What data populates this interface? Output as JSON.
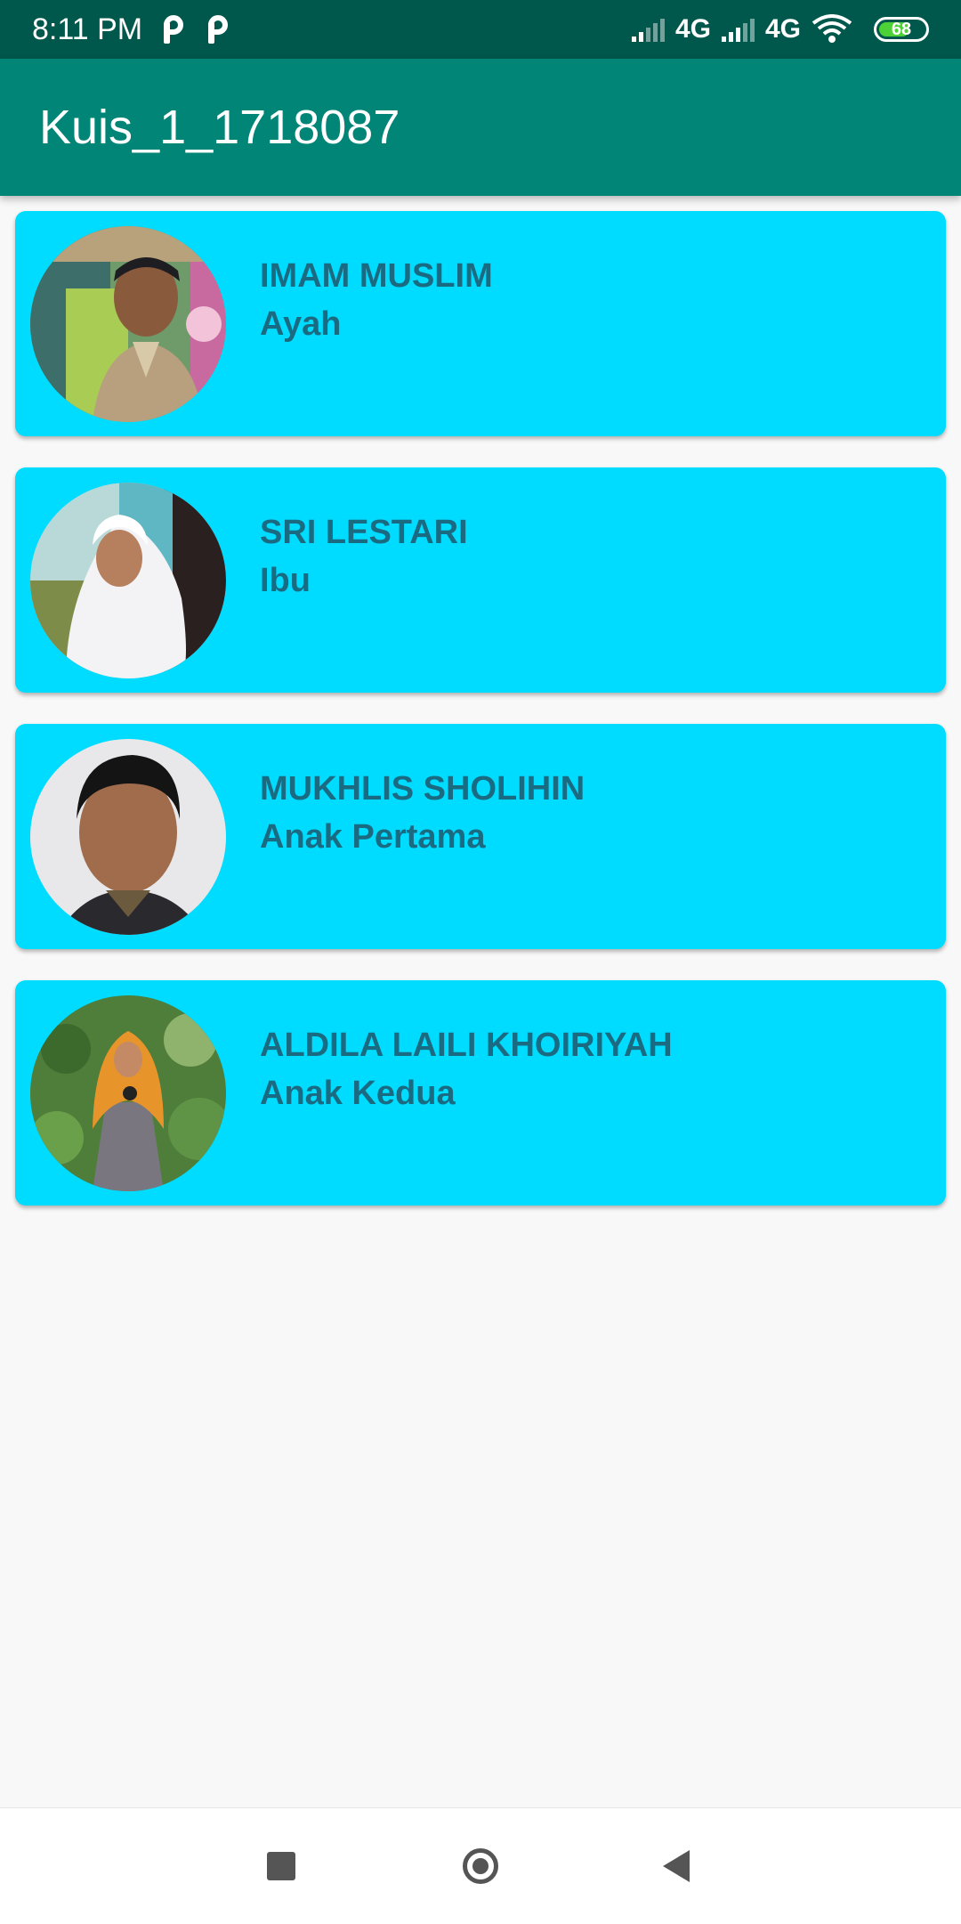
{
  "status_bar": {
    "time": "8:11 PM",
    "network1": "4G",
    "network2": "4G",
    "battery": "68",
    "battery_level": 0.68,
    "icons": [
      "parking-p-icon",
      "parking-p-icon",
      "signal-icon",
      "signal-icon",
      "wifi-icon",
      "battery-icon"
    ]
  },
  "app_bar": {
    "title": "Kuis_1_1718087"
  },
  "members": [
    {
      "name": "IMAM MUSLIM",
      "role": "Ayah",
      "avatar": "man-in-uniform-photo"
    },
    {
      "name": "SRI LESTARI",
      "role": "Ibu",
      "avatar": "woman-in-white-hijab-photo"
    },
    {
      "name": "MUKHLIS SHOLIHIN",
      "role": "Anak Pertama",
      "avatar": "young-man-selfie-photo"
    },
    {
      "name": "ALDILA LAILI KHOIRIYAH",
      "role": "Anak Kedua",
      "avatar": "girl-in-orange-hijab-photo"
    }
  ],
  "colors": {
    "status_bar": "#00574b",
    "app_bar": "#008577",
    "card": "#00dcff",
    "card_text": "#1a6b82",
    "background": "#f8f8f8"
  },
  "nav_bar": {
    "icons": [
      "recents-square-icon",
      "home-circle-icon",
      "back-triangle-icon"
    ]
  }
}
